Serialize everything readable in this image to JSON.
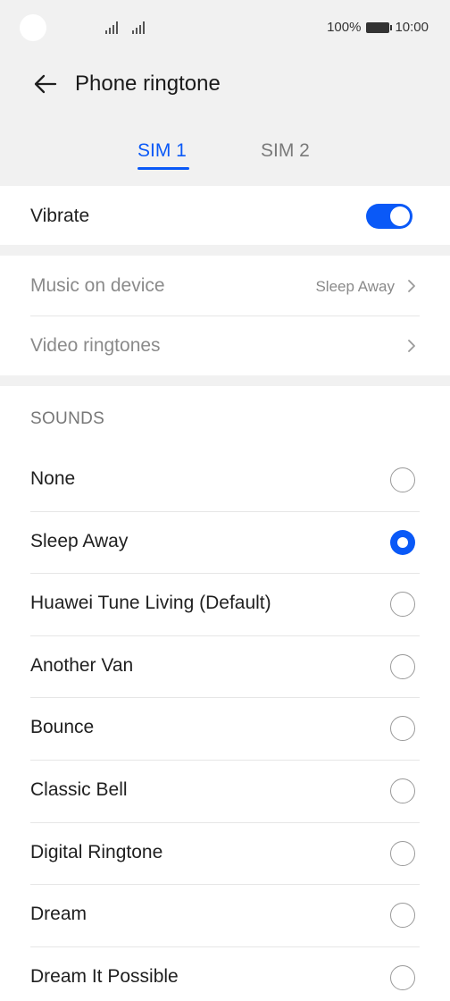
{
  "status_bar": {
    "battery": "100%",
    "time": "10:00",
    "icons": [
      "signal-icon",
      "signal-icon",
      "battery-icon"
    ]
  },
  "header": {
    "title": "Phone ringtone",
    "back_icon": "arrow-left-icon"
  },
  "tabs": [
    {
      "label": "SIM 1",
      "selected": true
    },
    {
      "label": "SIM 2",
      "selected": false
    }
  ],
  "vibrate": {
    "label": "Vibrate",
    "enabled": true
  },
  "media": {
    "music": {
      "label": "Music on device",
      "value": "Sleep Away"
    },
    "video": {
      "label": "Video ringtones"
    }
  },
  "sounds": {
    "title": "SOUNDS",
    "items": [
      {
        "label": "None",
        "selected": false
      },
      {
        "label": "Sleep Away",
        "selected": true
      },
      {
        "label": "Huawei Tune Living (Default)",
        "selected": false
      },
      {
        "label": "Another Van",
        "selected": false
      },
      {
        "label": "Bounce",
        "selected": false
      },
      {
        "label": "Classic Bell",
        "selected": false
      },
      {
        "label": "Digital Ringtone",
        "selected": false
      },
      {
        "label": "Dream",
        "selected": false
      },
      {
        "label": "Dream It Possible",
        "selected": false
      }
    ]
  },
  "colors": {
    "accent": "#0a59f7",
    "background": "#f1f1f1",
    "card": "#ffffff"
  }
}
